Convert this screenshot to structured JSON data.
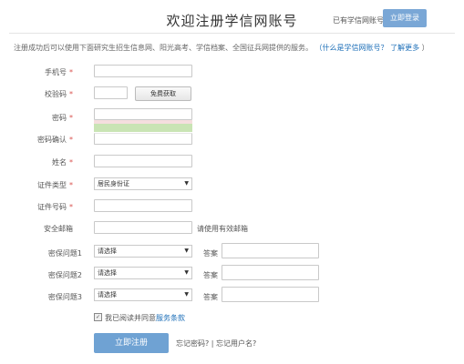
{
  "header": {
    "title": "欢迎注册学信网账号",
    "have_account": "已有学信网账号",
    "login_button": "立即登录"
  },
  "notice": {
    "text": "注册成功后可以使用下面研究生招生信息网、阳光高考、学信档案、全国征兵网提供的服务。",
    "link1": "（什么是学信网账号？",
    "link2": "了解更多",
    "close": "）"
  },
  "form": {
    "phone": {
      "label": "手机号",
      "required": "*",
      "value": ""
    },
    "captcha": {
      "label": "校验码",
      "required": "*",
      "value": "",
      "button": "免费获取"
    },
    "password": {
      "label": "密码",
      "required": "*",
      "value": ""
    },
    "password_confirm": {
      "label": "密码确认",
      "required": "*",
      "value": ""
    },
    "name": {
      "label": "姓名",
      "required": "*",
      "value": ""
    },
    "id_type": {
      "label": "证件类型",
      "required": "*",
      "selected": "居民身份证"
    },
    "id_number": {
      "label": "证件号码",
      "required": "*",
      "value": ""
    },
    "email": {
      "label": "安全邮箱",
      "value": "",
      "note": "请使用有效邮箱"
    },
    "questions": [
      {
        "label": "密保问题1",
        "selected": "请选择",
        "answer_label": "答案",
        "answer": ""
      },
      {
        "label": "密保问题2",
        "selected": "请选择",
        "answer_label": "答案",
        "answer": ""
      },
      {
        "label": "密保问题3",
        "selected": "请选择",
        "answer_label": "答案",
        "answer": ""
      }
    ],
    "agree_text": "我已阅读并同意",
    "agree_link": "服务条款",
    "submit": "立即注册",
    "forgot_password": "忘记密码?",
    "separator": "|",
    "forgot_username": "忘记用户名?"
  },
  "colors": {
    "accent": "#6fa2d3",
    "link": "#1d6fb8",
    "required": "#d9534f"
  }
}
